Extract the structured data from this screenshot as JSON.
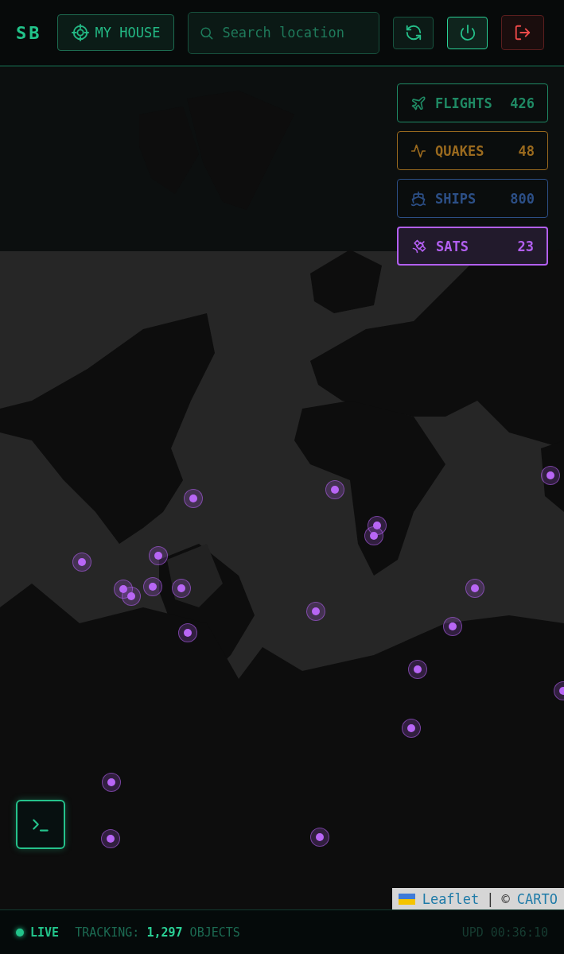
{
  "header": {
    "logo": "SB",
    "home_button": "MY HOUSE",
    "search": {
      "placeholder": "Search location"
    },
    "power": {
      "on": true
    }
  },
  "layers": [
    {
      "kind": "flights",
      "label": "FLIGHTS",
      "count": "426",
      "color": "#1f8a64",
      "selected": false
    },
    {
      "kind": "quakes",
      "label": "QUAKES",
      "count": "48",
      "color": "#9a6a1e",
      "selected": false
    },
    {
      "kind": "ships",
      "label": "SHIPS",
      "count": "800",
      "color": "#2c4f86",
      "selected": false
    },
    {
      "kind": "sats",
      "label": "SATS",
      "count": "23",
      "color": "#b25ff0",
      "selected": true
    }
  ],
  "attribution": {
    "link": "Leaflet",
    "separator": "|",
    "credit": "©",
    "provider": "CARTO"
  },
  "status_bar": {
    "live": "LIVE",
    "tracking": "TRACKING: **1,297** OBJECTS",
    "updated": "UPD 00:36:10"
  }
}
